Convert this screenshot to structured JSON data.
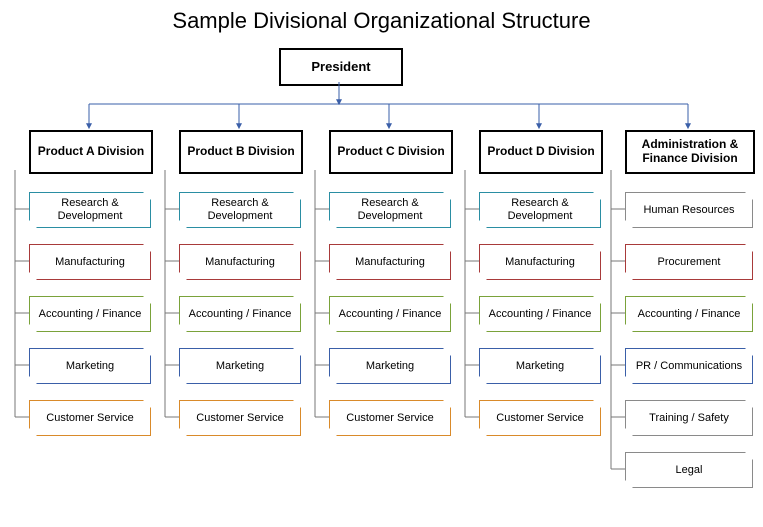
{
  "title": "Sample Divisional Organizational Structure",
  "president": "President",
  "divisions": [
    {
      "name": "Product  A Division",
      "depts": [
        {
          "label": "Research & Development",
          "color": "teal"
        },
        {
          "label": "Manufacturing",
          "color": "red"
        },
        {
          "label": "Accounting / Finance",
          "color": "green"
        },
        {
          "label": "Marketing",
          "color": "blue"
        },
        {
          "label": "Customer Service",
          "color": "orange"
        }
      ]
    },
    {
      "name": "Product  B Division",
      "depts": [
        {
          "label": "Research & Development",
          "color": "teal"
        },
        {
          "label": "Manufacturing",
          "color": "red"
        },
        {
          "label": "Accounting / Finance",
          "color": "green"
        },
        {
          "label": "Marketing",
          "color": "blue"
        },
        {
          "label": "Customer Service",
          "color": "orange"
        }
      ]
    },
    {
      "name": "Product  C Division",
      "depts": [
        {
          "label": "Research & Development",
          "color": "teal"
        },
        {
          "label": "Manufacturing",
          "color": "red"
        },
        {
          "label": "Accounting / Finance",
          "color": "green"
        },
        {
          "label": "Marketing",
          "color": "blue"
        },
        {
          "label": "Customer Service",
          "color": "orange"
        }
      ]
    },
    {
      "name": "Product  D Division",
      "depts": [
        {
          "label": "Research & Development",
          "color": "teal"
        },
        {
          "label": "Manufacturing",
          "color": "red"
        },
        {
          "label": "Accounting / Finance",
          "color": "green"
        },
        {
          "label": "Marketing",
          "color": "blue"
        },
        {
          "label": "Customer Service",
          "color": "orange"
        }
      ]
    },
    {
      "name": "Administration & Finance Division",
      "depts": [
        {
          "label": "Human Resources",
          "color": "gray"
        },
        {
          "label": "Procurement",
          "color": "red"
        },
        {
          "label": "Accounting / Finance",
          "color": "green"
        },
        {
          "label": "PR / Communications",
          "color": "blue"
        },
        {
          "label": "Training / Safety",
          "color": "gray"
        },
        {
          "label": "Legal",
          "color": "gray"
        }
      ]
    }
  ]
}
